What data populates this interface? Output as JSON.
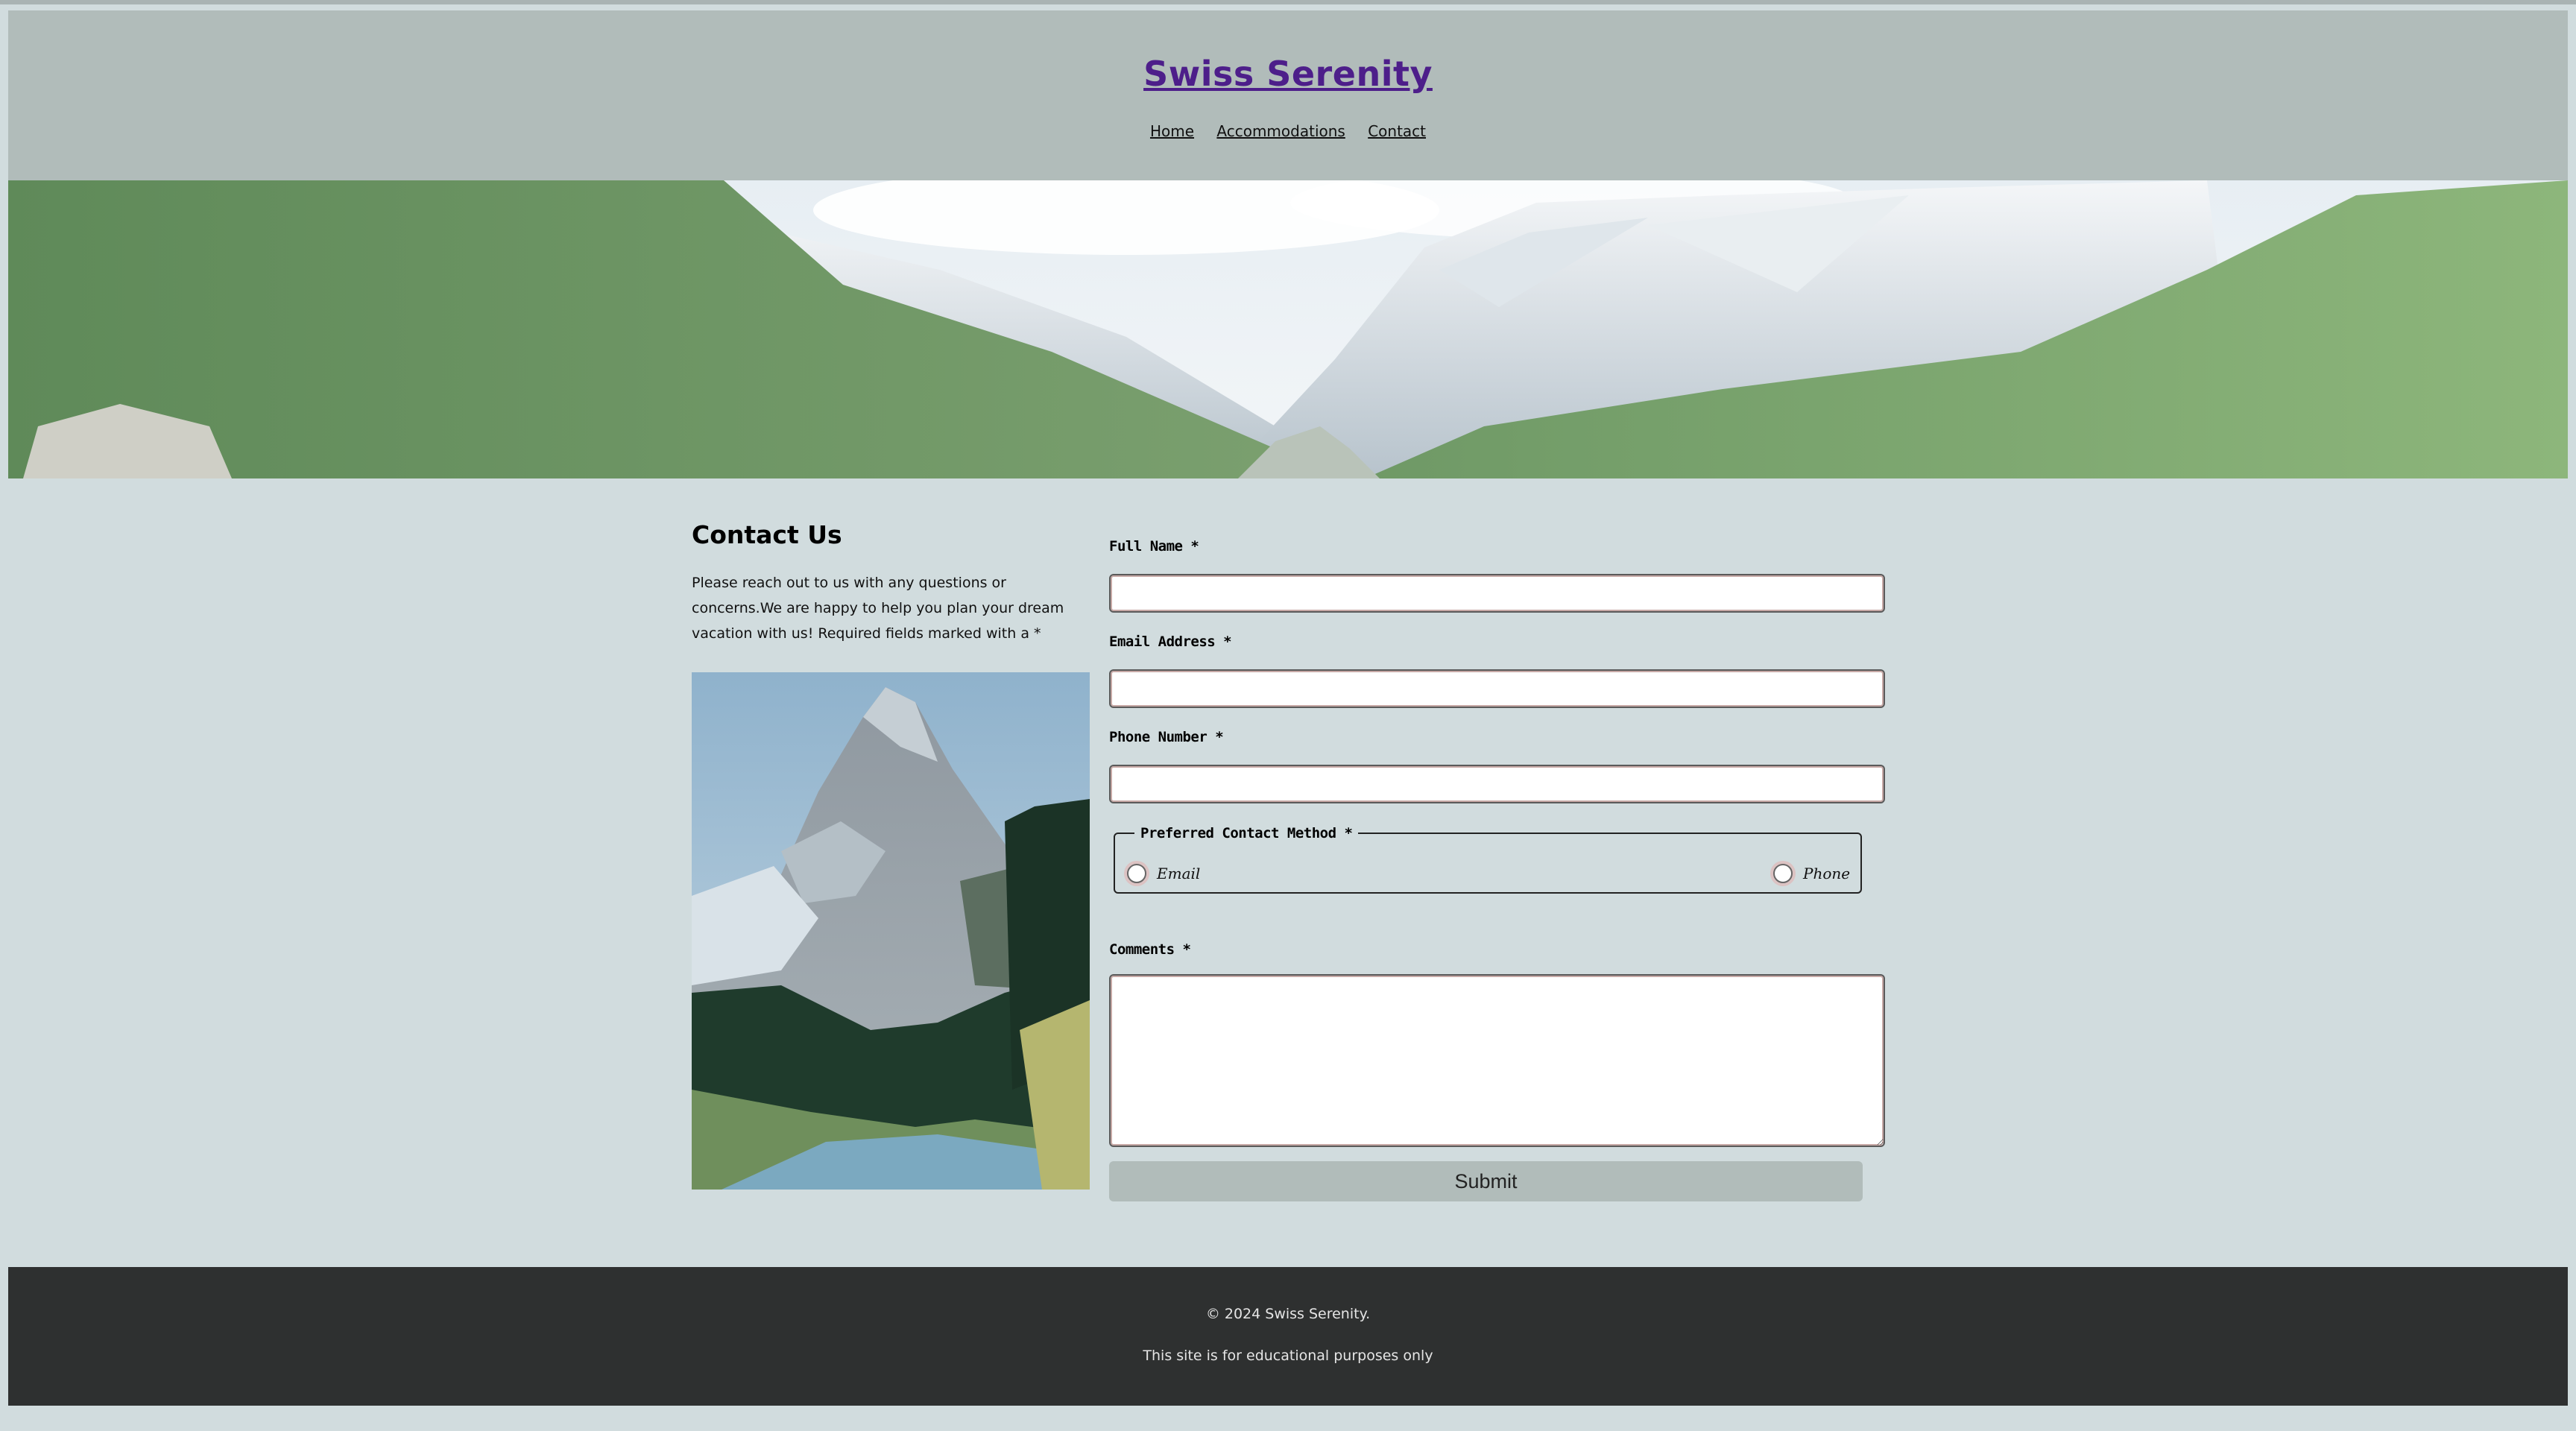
{
  "site": {
    "title": "Swiss Serenity"
  },
  "nav": {
    "items": [
      {
        "label": "Home"
      },
      {
        "label": "Accommodations"
      },
      {
        "label": "Contact"
      }
    ]
  },
  "intro": {
    "heading": "Contact Us",
    "text": "Please reach out to us with any questions or concerns.We are happy to help you plan your dream vacation with us! Required fields marked with a *"
  },
  "form": {
    "full_name_label": "Full Name *",
    "email_label": "Email Address *",
    "phone_label": "Phone Number *",
    "contact_method_legend": "Preferred Contact Method *",
    "contact_method_options": [
      "Email",
      "Phone"
    ],
    "comments_label": "Comments *",
    "submit_label": "Submit"
  },
  "footer": {
    "copyright": "© 2024 Swiss Serenity.",
    "note": "This site is for educational purposes only"
  },
  "colors": {
    "page_bg": "#d1dcde",
    "header_bg": "#b1bcba",
    "title_link": "#4d1e8a",
    "footer_bg": "#2e3030"
  }
}
